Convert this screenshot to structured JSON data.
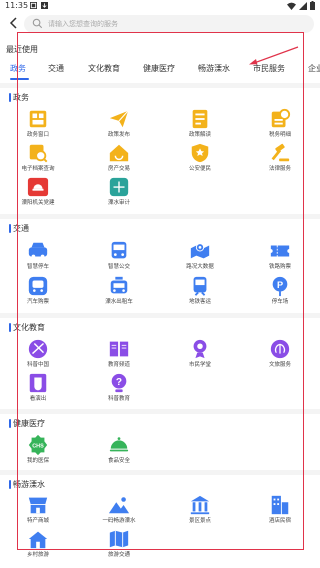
{
  "status_bar": {
    "time": "11:35"
  },
  "search": {
    "placeholder": "请输入您想查询的服务"
  },
  "recent": {
    "title": "最近使用"
  },
  "tabs": [
    {
      "label": "政务"
    },
    {
      "label": "交通"
    },
    {
      "label": "文化教育"
    },
    {
      "label": "健康医疗"
    },
    {
      "label": "畅游溧水"
    },
    {
      "label": "市民服务"
    },
    {
      "label": "企业"
    }
  ],
  "sections": {
    "gov": {
      "title": "政务",
      "items": [
        {
          "label": "政务窗口",
          "icon": "government-window-icon"
        },
        {
          "label": "政策发布",
          "icon": "policy-release-icon"
        },
        {
          "label": "政策解读",
          "icon": "policy-interpretation-icon"
        },
        {
          "label": "税务明细",
          "icon": "tax-detail-icon"
        },
        {
          "label": "电子档案查询",
          "icon": "e-archive-search-icon"
        },
        {
          "label": "房产交易",
          "icon": "house-trade-icon"
        },
        {
          "label": "公安便民",
          "icon": "police-service-icon"
        },
        {
          "label": "法律服务",
          "icon": "legal-service-icon"
        },
        {
          "label": "溧阳机关党建",
          "icon": "party-building-icon"
        },
        {
          "label": "溧水审计",
          "icon": "audit-icon"
        }
      ]
    },
    "traffic": {
      "title": "交通",
      "items": [
        {
          "label": "智慧停车",
          "icon": "smart-parking-icon"
        },
        {
          "label": "智慧公交",
          "icon": "smart-bus-icon"
        },
        {
          "label": "路况大数据",
          "icon": "traffic-data-icon"
        },
        {
          "label": "铁路购票",
          "icon": "railway-ticket-icon"
        },
        {
          "label": "汽车购票",
          "icon": "bus-ticket-icon"
        },
        {
          "label": "溧水出租车",
          "icon": "taxi-icon"
        },
        {
          "label": "地铁客运",
          "icon": "metro-icon"
        },
        {
          "label": "停车场",
          "icon": "parking-lot-icon"
        }
      ]
    },
    "culture": {
      "title": "文化教育",
      "items": [
        {
          "label": "科普中国",
          "icon": "science-china-icon"
        },
        {
          "label": "教育频道",
          "icon": "education-channel-icon"
        },
        {
          "label": "市民学堂",
          "icon": "citizen-school-icon"
        },
        {
          "label": "文旅服务",
          "icon": "culture-tourism-icon"
        },
        {
          "label": "看演出",
          "icon": "show-icon"
        },
        {
          "label": "科普教育",
          "icon": "science-education-icon"
        }
      ]
    },
    "health": {
      "title": "健康医疗",
      "items": [
        {
          "label": "我的医保",
          "icon": "medical-insurance-icon"
        },
        {
          "label": "食品安全",
          "icon": "food-safety-icon"
        }
      ]
    },
    "travel": {
      "title": "畅游溧水",
      "items": [
        {
          "label": "特产商城",
          "icon": "specialty-mall-icon"
        },
        {
          "label": "一码畅游溧水",
          "icon": "travel-code-icon"
        },
        {
          "label": "景区景点",
          "icon": "scenic-spot-icon"
        },
        {
          "label": "酒店民宿",
          "icon": "hotel-icon"
        },
        {
          "label": "乡村旅游",
          "icon": "rural-tourism-icon"
        },
        {
          "label": "旅游交通",
          "icon": "tourism-traffic-icon"
        }
      ]
    }
  },
  "colors": {
    "accent": "#2f67e8",
    "gold": "#f3b21b",
    "blue": "#3f7ef0",
    "purple": "#8a4de6",
    "green": "#36b45a",
    "red": "#e53935",
    "teal": "#2aa39a",
    "annotation_red": "#e0334a"
  }
}
